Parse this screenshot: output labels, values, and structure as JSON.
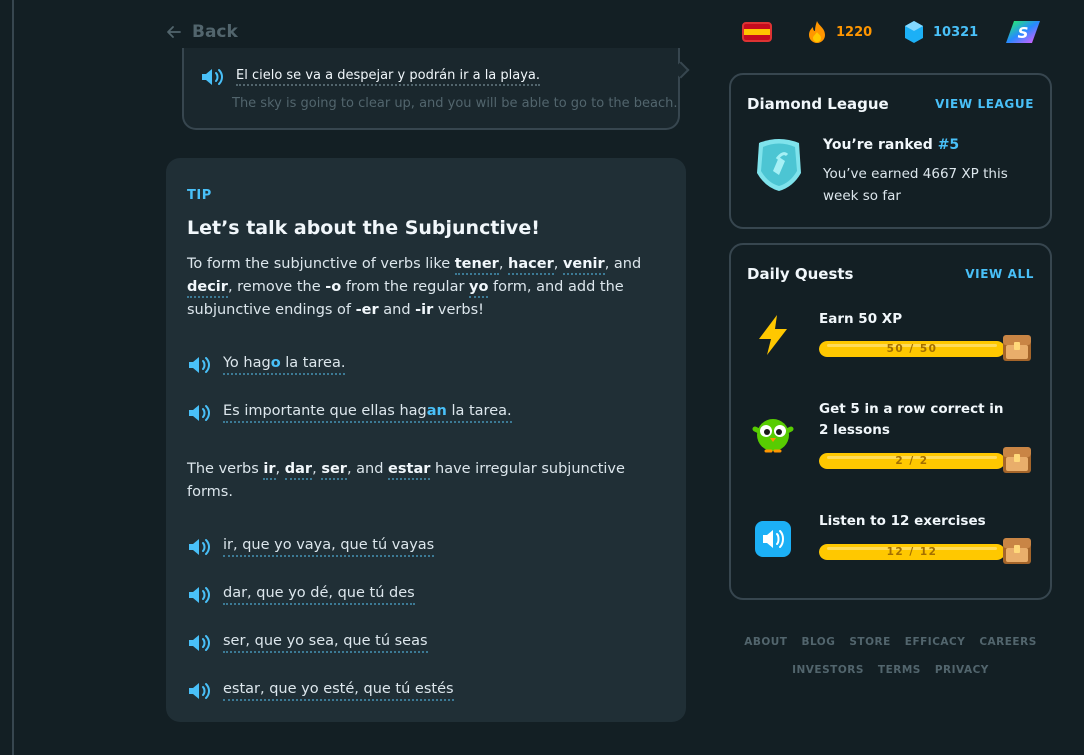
{
  "nav": {
    "back_label": "Back"
  },
  "stats": {
    "streak": "1220",
    "gems": "10321"
  },
  "sentence": {
    "es": "El cielo se va a despejar y podrán ir a la playa.",
    "en": "The sky is going to clear up, and you will be able to go to the beach."
  },
  "tip": {
    "label": "TIP",
    "title": "Let’s talk about the Subjunctive!",
    "p1": {
      "t1": "To form the subjunctive of verbs like ",
      "w1": "tener",
      "c1": ", ",
      "w2": "hacer",
      "c2": ", ",
      "w3": "venir",
      "c3": ", and ",
      "w4": "decir",
      "t2": ", remove the ",
      "w5": "-o",
      "t3": " from the regular ",
      "w6": "yo",
      "t4": " form, and add the subjunctive endings of ",
      "w7": "-er",
      "t5": " and ",
      "w8": "-ir",
      "t6": " verbs!"
    },
    "ex1": {
      "a": "Yo hag",
      "b": "o",
      "c": " la tarea."
    },
    "ex2": {
      "a": "Es importante que ellas hag",
      "b": "an",
      "c": " la tarea."
    },
    "p2": {
      "t1": "The verbs ",
      "w1": "ir",
      "c1": ", ",
      "w2": "dar",
      "c2": ", ",
      "w3": "ser",
      "c3": ", and ",
      "w4": "estar",
      "t2": " have irregular subjunctive forms."
    },
    "forms": [
      "ir, que yo vaya, que tú vayas",
      "dar, que yo dé, que tú des",
      "ser, que yo sea, que tú seas",
      "estar, que yo esté, que tú estés"
    ]
  },
  "league": {
    "title": "Diamond League",
    "link": "VIEW LEAGUE",
    "rank_prefix": "You’re ranked ",
    "rank": "#5",
    "desc": "You’ve earned 4667 XP this week so far"
  },
  "quests": {
    "title": "Daily Quests",
    "link": "VIEW ALL",
    "items": [
      {
        "title": "Earn 50 XP",
        "progress": "50 / 50",
        "value": 1.0,
        "icon": "lightning-icon"
      },
      {
        "title": "Get 5 in a row correct in 2 lessons",
        "progress": "2 / 2",
        "value": 1.0,
        "icon": "owl-icon"
      },
      {
        "title": "Listen to 12 exercises",
        "progress": "12 / 12",
        "value": 1.0,
        "icon": "speaker-icon"
      }
    ]
  },
  "footer": {
    "row1": [
      "ABOUT",
      "BLOG",
      "STORE",
      "EFFICACY",
      "CAREERS"
    ],
    "row2": [
      "INVESTORS",
      "TERMS",
      "PRIVACY"
    ]
  },
  "colors": {
    "accent": "#49c0f8",
    "background": "#131f24",
    "card": "#202f36",
    "progress": "#ffc800",
    "streak": "#ff9600"
  }
}
